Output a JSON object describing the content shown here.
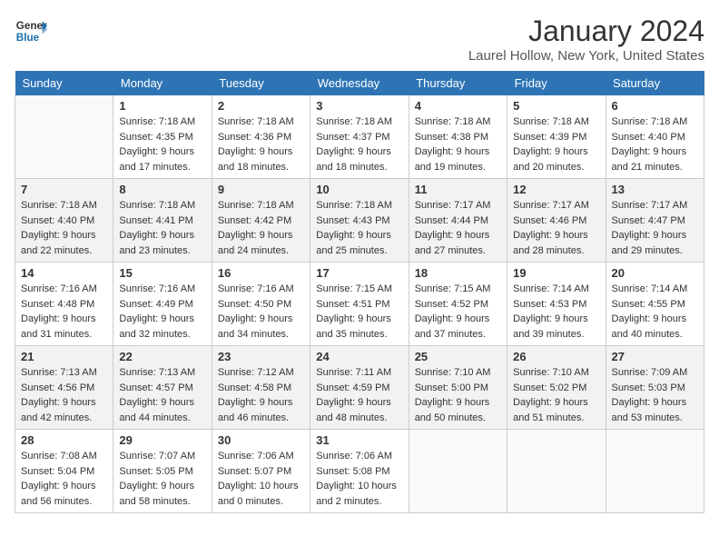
{
  "logo": {
    "general": "General",
    "blue": "Blue"
  },
  "header": {
    "title": "January 2024",
    "location": "Laurel Hollow, New York, United States"
  },
  "weekdays": [
    "Sunday",
    "Monday",
    "Tuesday",
    "Wednesday",
    "Thursday",
    "Friday",
    "Saturday"
  ],
  "weeks": [
    [
      {
        "day": "",
        "sunrise": "",
        "sunset": "",
        "daylight": ""
      },
      {
        "day": "1",
        "sunrise": "Sunrise: 7:18 AM",
        "sunset": "Sunset: 4:35 PM",
        "daylight": "Daylight: 9 hours and 17 minutes."
      },
      {
        "day": "2",
        "sunrise": "Sunrise: 7:18 AM",
        "sunset": "Sunset: 4:36 PM",
        "daylight": "Daylight: 9 hours and 18 minutes."
      },
      {
        "day": "3",
        "sunrise": "Sunrise: 7:18 AM",
        "sunset": "Sunset: 4:37 PM",
        "daylight": "Daylight: 9 hours and 18 minutes."
      },
      {
        "day": "4",
        "sunrise": "Sunrise: 7:18 AM",
        "sunset": "Sunset: 4:38 PM",
        "daylight": "Daylight: 9 hours and 19 minutes."
      },
      {
        "day": "5",
        "sunrise": "Sunrise: 7:18 AM",
        "sunset": "Sunset: 4:39 PM",
        "daylight": "Daylight: 9 hours and 20 minutes."
      },
      {
        "day": "6",
        "sunrise": "Sunrise: 7:18 AM",
        "sunset": "Sunset: 4:40 PM",
        "daylight": "Daylight: 9 hours and 21 minutes."
      }
    ],
    [
      {
        "day": "7",
        "sunrise": "Sunrise: 7:18 AM",
        "sunset": "Sunset: 4:40 PM",
        "daylight": "Daylight: 9 hours and 22 minutes."
      },
      {
        "day": "8",
        "sunrise": "Sunrise: 7:18 AM",
        "sunset": "Sunset: 4:41 PM",
        "daylight": "Daylight: 9 hours and 23 minutes."
      },
      {
        "day": "9",
        "sunrise": "Sunrise: 7:18 AM",
        "sunset": "Sunset: 4:42 PM",
        "daylight": "Daylight: 9 hours and 24 minutes."
      },
      {
        "day": "10",
        "sunrise": "Sunrise: 7:18 AM",
        "sunset": "Sunset: 4:43 PM",
        "daylight": "Daylight: 9 hours and 25 minutes."
      },
      {
        "day": "11",
        "sunrise": "Sunrise: 7:17 AM",
        "sunset": "Sunset: 4:44 PM",
        "daylight": "Daylight: 9 hours and 27 minutes."
      },
      {
        "day": "12",
        "sunrise": "Sunrise: 7:17 AM",
        "sunset": "Sunset: 4:46 PM",
        "daylight": "Daylight: 9 hours and 28 minutes."
      },
      {
        "day": "13",
        "sunrise": "Sunrise: 7:17 AM",
        "sunset": "Sunset: 4:47 PM",
        "daylight": "Daylight: 9 hours and 29 minutes."
      }
    ],
    [
      {
        "day": "14",
        "sunrise": "Sunrise: 7:16 AM",
        "sunset": "Sunset: 4:48 PM",
        "daylight": "Daylight: 9 hours and 31 minutes."
      },
      {
        "day": "15",
        "sunrise": "Sunrise: 7:16 AM",
        "sunset": "Sunset: 4:49 PM",
        "daylight": "Daylight: 9 hours and 32 minutes."
      },
      {
        "day": "16",
        "sunrise": "Sunrise: 7:16 AM",
        "sunset": "Sunset: 4:50 PM",
        "daylight": "Daylight: 9 hours and 34 minutes."
      },
      {
        "day": "17",
        "sunrise": "Sunrise: 7:15 AM",
        "sunset": "Sunset: 4:51 PM",
        "daylight": "Daylight: 9 hours and 35 minutes."
      },
      {
        "day": "18",
        "sunrise": "Sunrise: 7:15 AM",
        "sunset": "Sunset: 4:52 PM",
        "daylight": "Daylight: 9 hours and 37 minutes."
      },
      {
        "day": "19",
        "sunrise": "Sunrise: 7:14 AM",
        "sunset": "Sunset: 4:53 PM",
        "daylight": "Daylight: 9 hours and 39 minutes."
      },
      {
        "day": "20",
        "sunrise": "Sunrise: 7:14 AM",
        "sunset": "Sunset: 4:55 PM",
        "daylight": "Daylight: 9 hours and 40 minutes."
      }
    ],
    [
      {
        "day": "21",
        "sunrise": "Sunrise: 7:13 AM",
        "sunset": "Sunset: 4:56 PM",
        "daylight": "Daylight: 9 hours and 42 minutes."
      },
      {
        "day": "22",
        "sunrise": "Sunrise: 7:13 AM",
        "sunset": "Sunset: 4:57 PM",
        "daylight": "Daylight: 9 hours and 44 minutes."
      },
      {
        "day": "23",
        "sunrise": "Sunrise: 7:12 AM",
        "sunset": "Sunset: 4:58 PM",
        "daylight": "Daylight: 9 hours and 46 minutes."
      },
      {
        "day": "24",
        "sunrise": "Sunrise: 7:11 AM",
        "sunset": "Sunset: 4:59 PM",
        "daylight": "Daylight: 9 hours and 48 minutes."
      },
      {
        "day": "25",
        "sunrise": "Sunrise: 7:10 AM",
        "sunset": "Sunset: 5:00 PM",
        "daylight": "Daylight: 9 hours and 50 minutes."
      },
      {
        "day": "26",
        "sunrise": "Sunrise: 7:10 AM",
        "sunset": "Sunset: 5:02 PM",
        "daylight": "Daylight: 9 hours and 51 minutes."
      },
      {
        "day": "27",
        "sunrise": "Sunrise: 7:09 AM",
        "sunset": "Sunset: 5:03 PM",
        "daylight": "Daylight: 9 hours and 53 minutes."
      }
    ],
    [
      {
        "day": "28",
        "sunrise": "Sunrise: 7:08 AM",
        "sunset": "Sunset: 5:04 PM",
        "daylight": "Daylight: 9 hours and 56 minutes."
      },
      {
        "day": "29",
        "sunrise": "Sunrise: 7:07 AM",
        "sunset": "Sunset: 5:05 PM",
        "daylight": "Daylight: 9 hours and 58 minutes."
      },
      {
        "day": "30",
        "sunrise": "Sunrise: 7:06 AM",
        "sunset": "Sunset: 5:07 PM",
        "daylight": "Daylight: 10 hours and 0 minutes."
      },
      {
        "day": "31",
        "sunrise": "Sunrise: 7:06 AM",
        "sunset": "Sunset: 5:08 PM",
        "daylight": "Daylight: 10 hours and 2 minutes."
      },
      {
        "day": "",
        "sunrise": "",
        "sunset": "",
        "daylight": ""
      },
      {
        "day": "",
        "sunrise": "",
        "sunset": "",
        "daylight": ""
      },
      {
        "day": "",
        "sunrise": "",
        "sunset": "",
        "daylight": ""
      }
    ]
  ],
  "colors": {
    "header_bg": "#2e74b5",
    "header_text": "#ffffff",
    "alt_row": "#f2f2f2"
  }
}
